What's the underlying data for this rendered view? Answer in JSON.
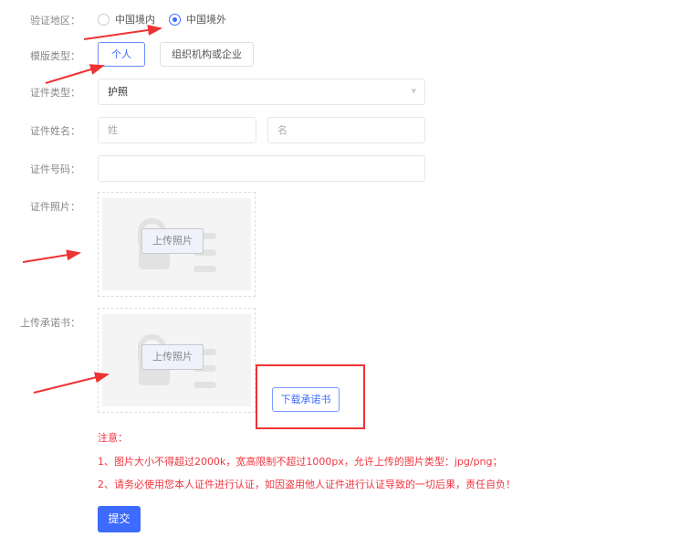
{
  "form": {
    "region": {
      "label": "验证地区：",
      "options": [
        "中国境内",
        "中国境外"
      ],
      "selected": "中国境外"
    },
    "template": {
      "label": "模版类型：",
      "options": [
        "个人",
        "组织机构或企业"
      ],
      "selected": "个人"
    },
    "id_type": {
      "label": "证件类型：",
      "value": "护照"
    },
    "id_name": {
      "label": "证件姓名：",
      "surname_placeholder": "姓",
      "given_placeholder": "名"
    },
    "id_number": {
      "label": "证件号码：",
      "value": ""
    },
    "id_photo": {
      "label": "证件照片：",
      "upload_label": "上传照片"
    },
    "commitment": {
      "label": "上传承诺书：",
      "upload_label": "上传照片",
      "download_label": "下载承诺书"
    },
    "notes": {
      "title": "注意：",
      "line1": "1、图片大小不得超过2000k，宽高限制不超过1000px，允许上传的图片类型：jpg/png；",
      "line2": "2、请务必使用您本人证件进行认证，如因盗用他人证件进行认证导致的一切后果，责任自负！"
    },
    "submit_label": "提交"
  },
  "colors": {
    "primary": "#3d6bff",
    "warning": "#f0353f",
    "annotation": "#ee3333"
  }
}
